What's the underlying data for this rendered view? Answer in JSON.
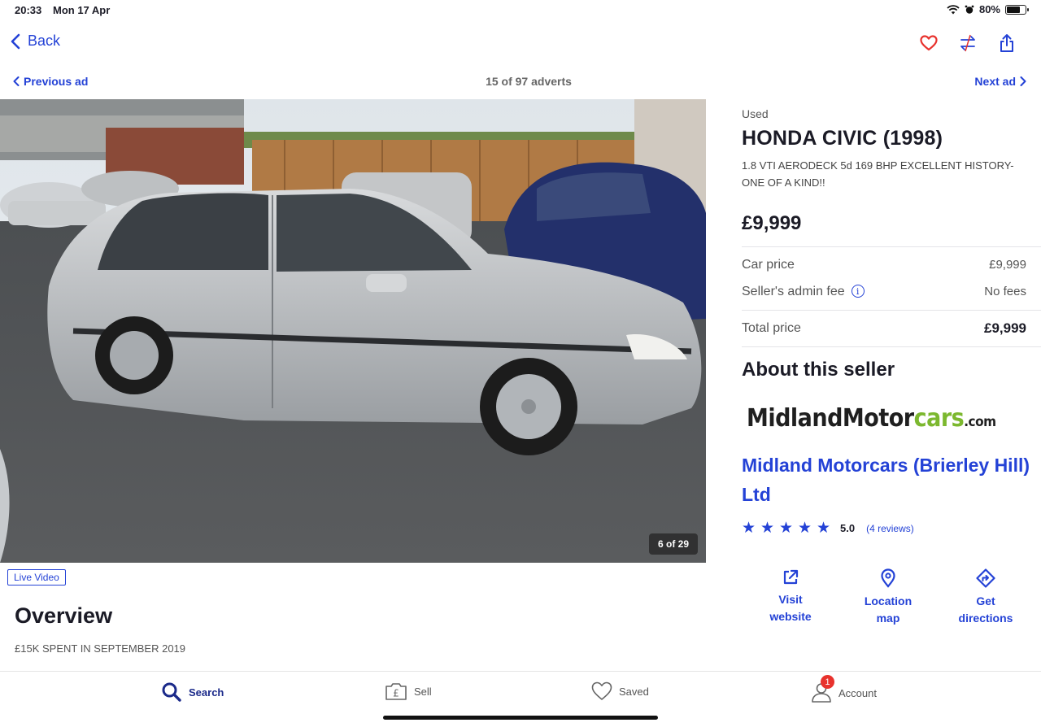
{
  "status": {
    "time": "20:33",
    "date": "Mon 17 Apr",
    "battery": "80%",
    "battery_level": 0.8
  },
  "nav": {
    "back_label": "Back"
  },
  "ad_nav": {
    "previous": "Previous ad",
    "counter": "15 of 97 adverts",
    "next": "Next ad"
  },
  "gallery": {
    "counter": "6 of 29",
    "live_video": "Live Video"
  },
  "overview": {
    "title": "Overview",
    "text": "£15K SPENT IN SEPTEMBER 2019"
  },
  "listing": {
    "condition": "Used",
    "title": "HONDA CIVIC (1998)",
    "subtitle": "1.8 VTI AERODECK 5d 169 BHP EXCELLENT HISTORY- ONE OF A KIND!!",
    "price": "£9,999",
    "price_rows": [
      {
        "label": "Car price",
        "value": "£9,999"
      },
      {
        "label": "Seller's admin fee",
        "value": "No fees"
      },
      {
        "label": "Total price",
        "value": "£9,999"
      }
    ]
  },
  "seller": {
    "section_title": "About this seller",
    "logo": {
      "part1": "MidlandMotor",
      "part2": "cars",
      "part3": ".com"
    },
    "name": "Midland Motorcars (Brierley Hill) Ltd",
    "rating": "5.0",
    "stars": 5,
    "reviews": "(4 reviews)",
    "actions": [
      {
        "label": "Visit website"
      },
      {
        "label": "Location map"
      },
      {
        "label": "Get directions"
      }
    ]
  },
  "tabs": [
    {
      "label": "Search"
    },
    {
      "label": "Sell"
    },
    {
      "label": "Saved"
    },
    {
      "label": "Account",
      "badge": "1"
    }
  ],
  "colors": {
    "accent": "#2442d6",
    "heart": "#e8322d",
    "logo_green": "#7cb82f"
  }
}
